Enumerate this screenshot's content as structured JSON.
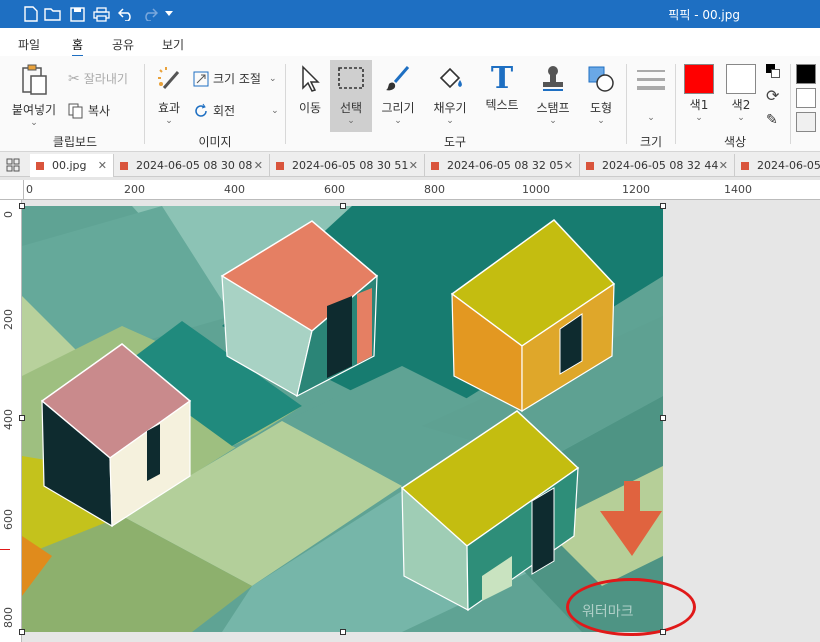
{
  "window": {
    "title": "픽픽 - 00.jpg"
  },
  "menu": {
    "items": [
      "파일",
      "홈",
      "공유",
      "보기"
    ],
    "active": "홈"
  },
  "clipboard": {
    "paste_label": "붙여넣기",
    "cut_label": "잘라내기",
    "copy_label": "복사",
    "group_label": "클립보드"
  },
  "image": {
    "effect_label": "효과",
    "resize_label": "크기 조절",
    "rotate_label": "회전",
    "group_label": "이미지"
  },
  "tools": {
    "move_label": "이동",
    "select_label": "선택",
    "draw_label": "그리기",
    "fill_label": "채우기",
    "text_label": "텍스트",
    "stamp_label": "스탬프",
    "shape_label": "도형",
    "group_label": "도구"
  },
  "size": {
    "group_label": "크기"
  },
  "colors": {
    "color1_label": "색1",
    "color2_label": "색2",
    "group_label": "색상",
    "color1": "#ff0000",
    "color2": "#ffffff"
  },
  "tabs": [
    "00.jpg",
    "2024-06-05 08 30 08",
    "2024-06-05 08 30 51",
    "2024-06-05 08 32 05",
    "2024-06-05 08 32 44",
    "2024-06-05"
  ],
  "ruler": {
    "horizontal": [
      "0",
      "200",
      "400",
      "600",
      "800",
      "1000",
      "1200",
      "1400"
    ],
    "vertical": [
      "0",
      "200",
      "400",
      "600",
      "800"
    ]
  },
  "canvas": {
    "watermark_text": "워터마크"
  },
  "accent": "#1e6fc2"
}
